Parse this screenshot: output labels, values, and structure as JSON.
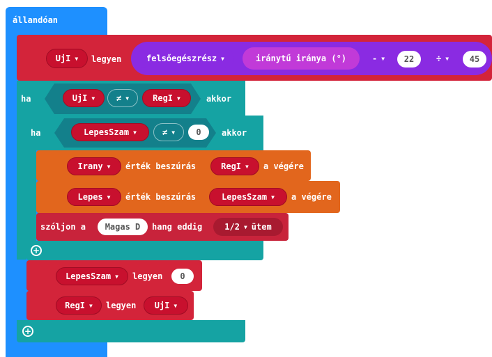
{
  "forever": {
    "label": "állandóan",
    "color": "#1e90ff"
  },
  "set_uji": {
    "var": "UjI",
    "set_label": "legyen",
    "op_func": "felsőegészrész",
    "compass": "iránytű iránya (°)",
    "minus_op": "-",
    "minus_value": "22",
    "div_op": "÷",
    "div_value": "45",
    "colors": {
      "variable": "#d3243a",
      "math": "#8a2be2",
      "input": "#c13ad8"
    }
  },
  "if_outer": {
    "if_label": "ha",
    "left": "UjI",
    "op": "≠",
    "right": "RegI",
    "then_label": "akkor",
    "color": "#15a3a3",
    "compare_color": "#13808b"
  },
  "if_inner": {
    "if_label": "ha",
    "left": "LepesSzam",
    "op": "≠",
    "right": "0",
    "then_label": "akkor"
  },
  "insert_irany": {
    "list": "Irany",
    "mid_label": "érték beszúrás",
    "value": "RegI",
    "end_label": "a végére",
    "color": "#e2661d"
  },
  "insert_lepes": {
    "list": "Lepes",
    "mid_label": "érték beszúrás",
    "value": "LepesSzam",
    "end_label": "a végére"
  },
  "play_tone": {
    "prefix": "szóljon a",
    "note": "Magas D",
    "mid_label": "hang eddig",
    "beat": "1/2",
    "beat_suffix": "ütem",
    "color": "#c8233b"
  },
  "set_lepesszam": {
    "var": "LepesSzam",
    "set_label": "legyen",
    "value": "0"
  },
  "set_regi": {
    "var": "RegI",
    "set_label": "legyen",
    "value": "UjI"
  }
}
